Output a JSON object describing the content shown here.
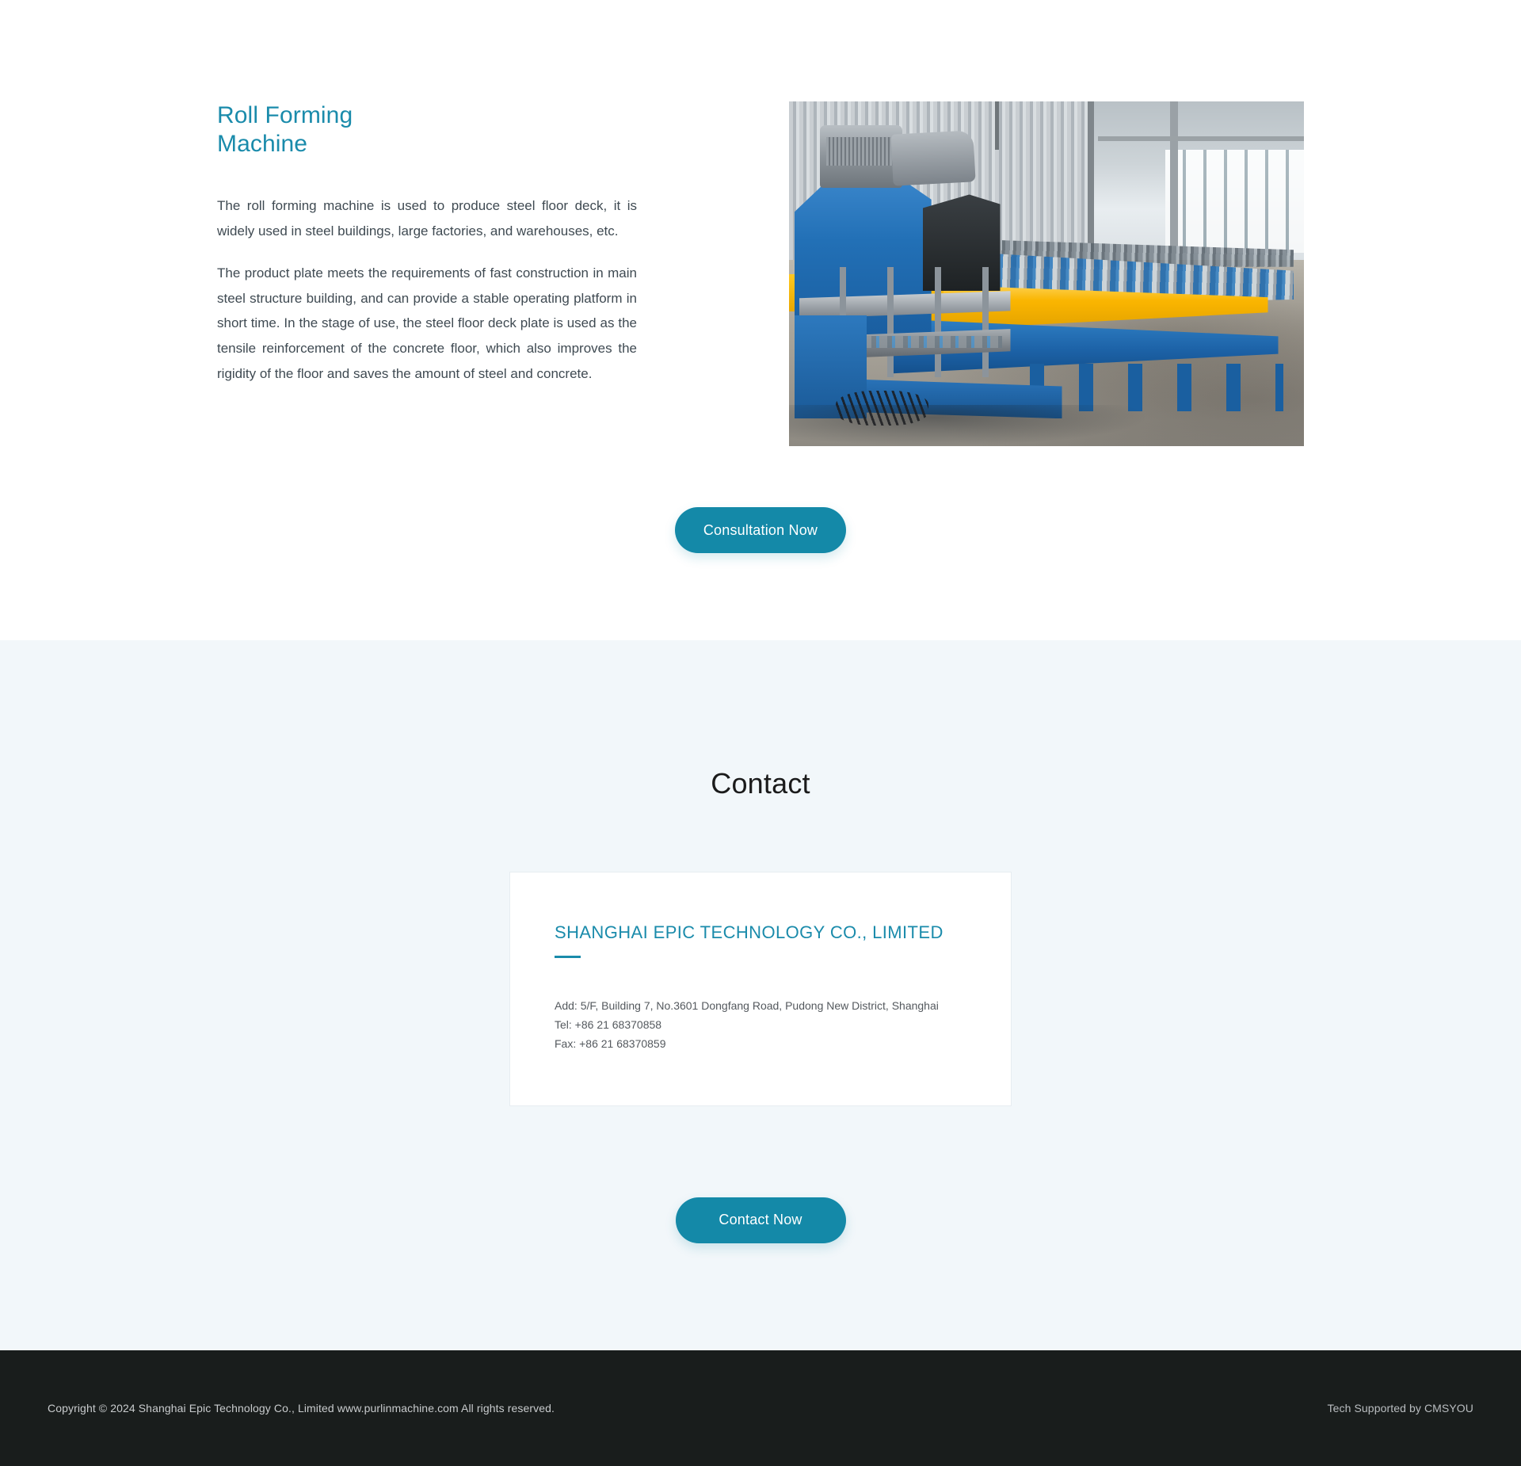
{
  "product": {
    "title": "Roll Forming Machine",
    "paragraphs": [
      "The roll forming machine is used to produce steel floor deck, it is widely used in steel buildings, large factories, and warehouses, etc.",
      "The product plate meets the requirements of fast construction in main steel structure building, and can provide a stable operating platform in short time. In the stage of use, the steel floor deck plate is used as the tensile reinforcement of the concrete floor, which also improves the rigidity of the floor and saves the amount of steel and concrete."
    ],
    "image_alt": "Blue and yellow steel floor deck roll forming machine line in a factory workshop",
    "cta_label": "Consultation Now"
  },
  "contact": {
    "heading": "Contact",
    "company": "SHANGHAI EPIC TECHNOLOGY CO., LIMITED",
    "address": "Add: 5/F, Building 7, No.3601 Dongfang Road, Pudong New District, Shanghai",
    "tel": "Tel: +86 21 68370858",
    "fax": "Fax: +86 21 68370859",
    "cta_label": "Contact Now"
  },
  "footer": {
    "copyright": "Copyright © 2024 Shanghai Epic Technology Co., Limited www.purlinmachine.com All rights reserved.",
    "tech": "Tech Supported by CMSYOU"
  },
  "colors": {
    "accent": "#1a8bab",
    "button": "#1489a8",
    "contact_bg": "#f2f7fa",
    "footer_bg": "#191d1c",
    "body_text": "#3f4a52"
  }
}
